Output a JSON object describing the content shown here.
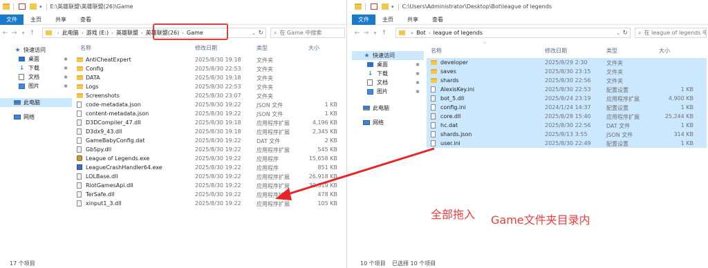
{
  "left": {
    "title": "E:\\英雄联盟\\英雄联盟(26)\\Game",
    "ribbon": {
      "tab_file": "文件",
      "tab_home": "主页",
      "tab_share": "共享",
      "tab_view": "查看"
    },
    "address": {
      "root": "此电脑",
      "segments": [
        "游戏 (E:)",
        "英雄联盟",
        "英雄联盟(26)",
        "Game"
      ]
    },
    "search_placeholder": "在 Game 中搜索",
    "sidebar": {
      "quick_access": "快速访问",
      "items": [
        "桌面",
        "下载",
        "文档",
        "图片"
      ],
      "this_pc": "此电脑",
      "network": "网络"
    },
    "columns": {
      "name": "名称",
      "date": "修改日期",
      "type": "类型",
      "size": "大小"
    },
    "files": [
      {
        "name": "AntiCheatExpert",
        "date": "2025/8/30 19:18",
        "type": "文件夹",
        "size": "",
        "icon": "folder"
      },
      {
        "name": "Config",
        "date": "2025/8/30 22:53",
        "type": "文件夹",
        "size": "",
        "icon": "folder"
      },
      {
        "name": "DATA",
        "date": "2025/8/30 19:18",
        "type": "文件夹",
        "size": "",
        "icon": "folder"
      },
      {
        "name": "Logs",
        "date": "2025/8/30 22:53",
        "type": "文件夹",
        "size": "",
        "icon": "folder"
      },
      {
        "name": "Screenshots",
        "date": "2025/8/30 23:07",
        "type": "文件夹",
        "size": "",
        "icon": "folder"
      },
      {
        "name": "code-metadata.json",
        "date": "2025/8/30 19:22",
        "type": "JSON 文件",
        "size": "1 KB",
        "icon": "file"
      },
      {
        "name": "content-metadata.json",
        "date": "2025/8/30 19:22",
        "type": "JSON 文件",
        "size": "1 KB",
        "icon": "file"
      },
      {
        "name": "D3DCompiler_47.dll",
        "date": "2025/8/30 19:18",
        "type": "应用程序扩展",
        "size": "4,196 KB",
        "icon": "dll"
      },
      {
        "name": "D3dx9_43.dll",
        "date": "2025/8/30 19:18",
        "type": "应用程序扩展",
        "size": "2,345 KB",
        "icon": "dll"
      },
      {
        "name": "GameBabyConfig.dat",
        "date": "2025/8/30 19:22",
        "type": "DAT 文件",
        "size": "2 KB",
        "icon": "file"
      },
      {
        "name": "GbSpy.dll",
        "date": "2025/8/30 19:22",
        "type": "应用程序扩展",
        "size": "545 KB",
        "icon": "dll"
      },
      {
        "name": "League of Legends.exe",
        "date": "2025/8/30 19:22",
        "type": "应用程序",
        "size": "15,658 KB",
        "icon": "exe"
      },
      {
        "name": "LeagueCrashHandler64.exe",
        "date": "2025/8/30 19:22",
        "type": "应用程序",
        "size": "851 KB",
        "icon": "exe2"
      },
      {
        "name": "LOLBase.dll",
        "date": "2025/8/30 19:22",
        "type": "应用程序扩展",
        "size": "26,918 KB",
        "icon": "dll"
      },
      {
        "name": "RiotGamesApi.dll",
        "date": "2025/8/30 19:22",
        "type": "应用程序扩展",
        "size": "30,319 KB",
        "icon": "dll"
      },
      {
        "name": "TerSafe.dll",
        "date": "2025/8/30 19:22",
        "type": "应用程序扩展",
        "size": "478 KB",
        "icon": "dll"
      },
      {
        "name": "xinput1_3.dll",
        "date": "2025/8/30 19:22",
        "type": "应用程序扩展",
        "size": "105 KB",
        "icon": "dll"
      }
    ],
    "status": "17 个项目"
  },
  "right": {
    "title": "C:\\Users\\Administrator\\Desktop\\Bot\\league of legends",
    "ribbon": {
      "tab_file": "文件",
      "tab_home": "主页",
      "tab_share": "共享",
      "tab_view": "查看"
    },
    "address": {
      "segments": [
        "Bot",
        "league of legends"
      ]
    },
    "search_placeholder": "在 league of legends 中搜索",
    "sidebar": {
      "quick_access": "快速访问",
      "items": [
        "桌面",
        "下载",
        "文档",
        "图片"
      ],
      "this_pc": "此电脑",
      "network": "网络"
    },
    "columns": {
      "name": "名称",
      "date": "修改日期",
      "type": "类型",
      "size": "大小"
    },
    "files": [
      {
        "name": "developer",
        "date": "2025/8/29 2:30",
        "type": "文件夹",
        "size": "",
        "icon": "folder"
      },
      {
        "name": "saves",
        "date": "2025/8/30 23:15",
        "type": "文件夹",
        "size": "",
        "icon": "folder"
      },
      {
        "name": "shards",
        "date": "2025/8/30 22:56",
        "type": "文件夹",
        "size": "",
        "icon": "folder"
      },
      {
        "name": "AlexisKey.ini",
        "date": "2025/8/30 22:53",
        "type": "配置设置",
        "size": "1 KB",
        "icon": "file"
      },
      {
        "name": "bot_5.dll",
        "date": "2025/8/24 23:19",
        "type": "应用程序扩展",
        "size": "4,900 KB",
        "icon": "dll"
      },
      {
        "name": "config.ini",
        "date": "2024/1/24 14:37",
        "type": "配置设置",
        "size": "1 KB",
        "icon": "file"
      },
      {
        "name": "core.dll",
        "date": "2025/8/28 15:40",
        "type": "应用程序扩展",
        "size": "25,244 KB",
        "icon": "dll"
      },
      {
        "name": "hc.dat",
        "date": "2025/8/30 22:56",
        "type": "DAT 文件",
        "size": "1 KB",
        "icon": "file"
      },
      {
        "name": "shards.json",
        "date": "2025/8/13 3:55",
        "type": "JSON 文件",
        "size": "314 KB",
        "icon": "file"
      },
      {
        "name": "user.ini",
        "date": "2025/8/30 22:49",
        "type": "配置设置",
        "size": "1 KB",
        "icon": "file"
      }
    ],
    "status_items": "10 个项目",
    "status_selected": "已选择 10 个项目"
  },
  "annotation": {
    "text_drag": "全部拖入",
    "text_target": "Game文件夹目录内",
    "color": "#f03b3b"
  }
}
